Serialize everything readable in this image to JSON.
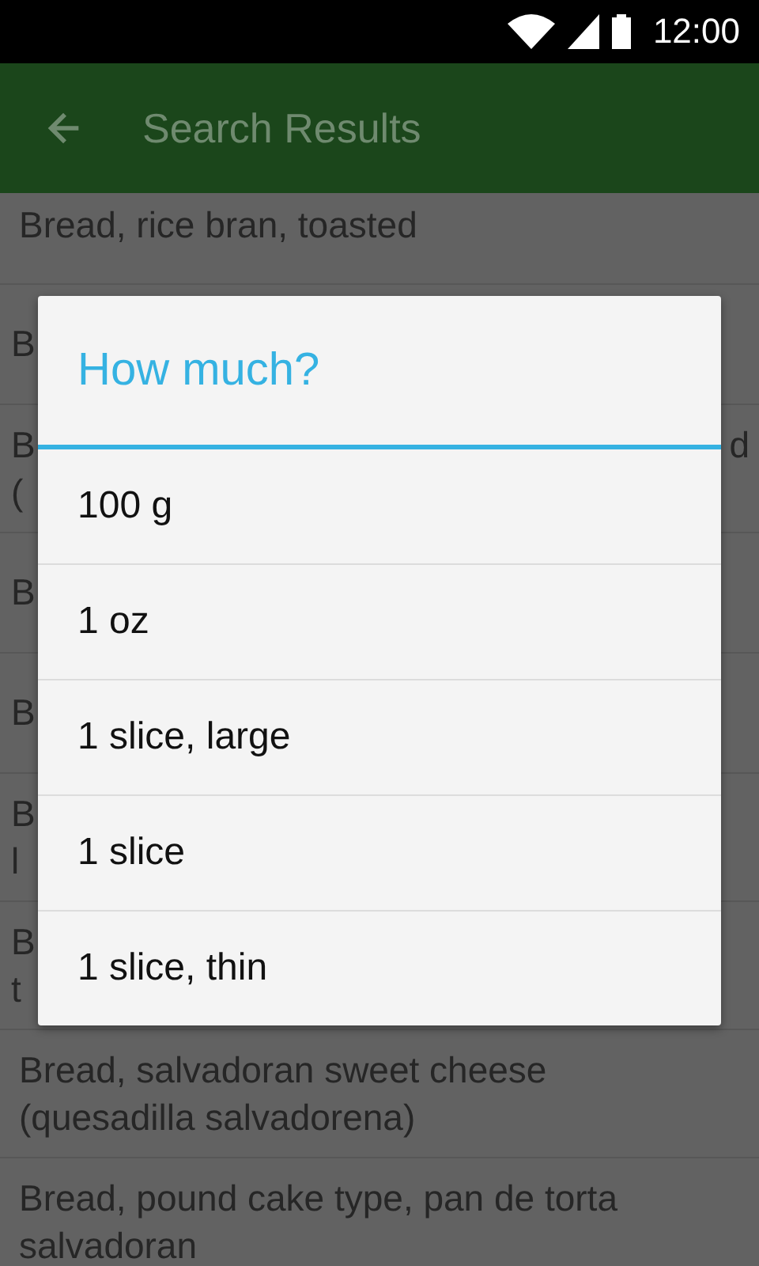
{
  "status_bar": {
    "time": "12:00"
  },
  "app_bar": {
    "title": "Search Results"
  },
  "results": [
    {
      "lines": [
        "Bread, rice bran, toasted"
      ]
    },
    {
      "lines": [
        "B"
      ]
    },
    {
      "lines": [
        "B",
        "("
      ],
      "right": "d"
    },
    {
      "lines": [
        "B"
      ]
    },
    {
      "lines": [
        "B"
      ]
    },
    {
      "lines": [
        "B",
        "l"
      ]
    },
    {
      "lines": [
        "B",
        "t"
      ]
    },
    {
      "lines": [
        "Bread, salvadoran sweet cheese",
        "(quesadilla salvadorena)"
      ]
    },
    {
      "lines": [
        "Bread, pound cake type, pan de torta",
        "salvadoran"
      ]
    }
  ],
  "dialog": {
    "title": "How much?",
    "options": [
      "100 g",
      "1 oz",
      "1 slice, large",
      "1 slice",
      "1 slice, thin"
    ]
  }
}
